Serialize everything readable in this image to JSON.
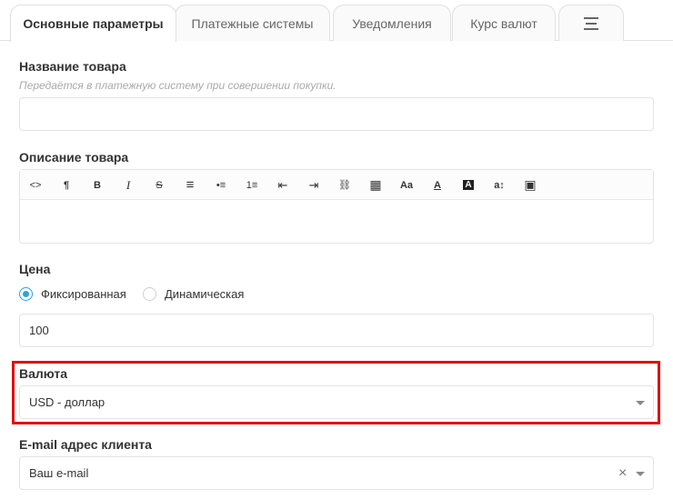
{
  "tabs": [
    {
      "label": "Основные параметры",
      "active": true
    },
    {
      "label": "Платежные системы",
      "active": false
    },
    {
      "label": "Уведомления",
      "active": false
    },
    {
      "label": "Курс валют",
      "active": false
    }
  ],
  "tabs_menu_icon": "menu-lines-icon",
  "product_name": {
    "label": "Название товара",
    "hint": "Передаётся в платежную систему при совершении покупки.",
    "value": ""
  },
  "product_description": {
    "label": "Описание товара",
    "toolbar": [
      {
        "name": "code-view-icon",
        "glyph": "<>"
      },
      {
        "name": "paragraph-icon",
        "glyph": "¶"
      },
      {
        "name": "bold-icon",
        "glyph": "B"
      },
      {
        "name": "italic-icon",
        "glyph": "I"
      },
      {
        "name": "strikethrough-icon",
        "glyph": "S"
      },
      {
        "name": "align-icon",
        "glyph": "≡"
      },
      {
        "name": "bullet-list-icon",
        "glyph": "•≡"
      },
      {
        "name": "numbered-list-icon",
        "glyph": "1≡"
      },
      {
        "name": "outdent-icon",
        "glyph": "⇤"
      },
      {
        "name": "indent-icon",
        "glyph": "⇥"
      },
      {
        "name": "link-icon",
        "glyph": "⛓"
      },
      {
        "name": "table-icon",
        "glyph": "▦"
      },
      {
        "name": "font-size-icon",
        "glyph": "Aa"
      },
      {
        "name": "text-color-icon",
        "glyph": "A"
      },
      {
        "name": "background-color-icon",
        "glyph": "A"
      },
      {
        "name": "line-height-icon",
        "glyph": "a↕"
      },
      {
        "name": "image-icon",
        "glyph": "▣"
      }
    ],
    "value": ""
  },
  "price": {
    "label": "Цена",
    "options": [
      {
        "label": "Фиксированная",
        "selected": true
      },
      {
        "label": "Динамическая",
        "selected": false
      }
    ],
    "value": "100"
  },
  "currency": {
    "label": "Валюта",
    "selected": "USD - доллар"
  },
  "client_email": {
    "label": "E-mail адрес клиента",
    "selected": "Ваш e-mail",
    "clear_glyph": "×"
  },
  "colors": {
    "accent": "#2aa3e0",
    "highlight": "#e01010"
  }
}
